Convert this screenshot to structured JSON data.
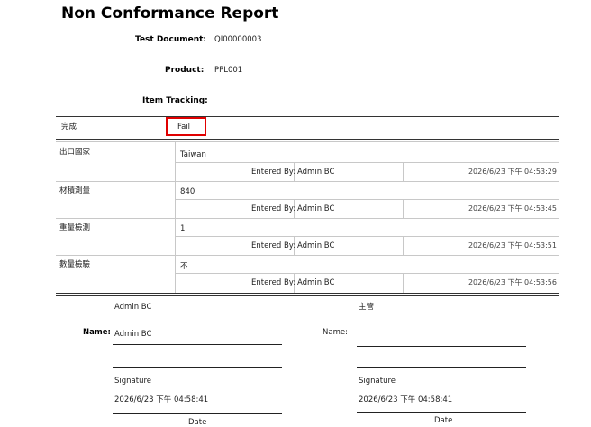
{
  "report": {
    "title": "Non Conformance Report",
    "test_document_label": "Test Document:",
    "test_document_value": "QI00000003",
    "product_label": "Product:",
    "product_value": "PPL001",
    "item_tracking_label": "Item Tracking:"
  },
  "status": {
    "label": "完成",
    "value": "Fail"
  },
  "entries": [
    {
      "name": "出口國家",
      "value": "Taiwan",
      "entered_by_label": "Entered By:",
      "entered_by": "Admin BC",
      "timestamp": "2026/6/23 下午 04:53:29"
    },
    {
      "name": "材積測量",
      "value": "840",
      "entered_by_label": "Entered By:",
      "entered_by": "Admin BC",
      "timestamp": "2026/6/23 下午 04:53:45"
    },
    {
      "name": "重量檢測",
      "value": "1",
      "entered_by_label": "Entered By:",
      "entered_by": "Admin BC",
      "timestamp": "2026/6/23 下午 04:53:51"
    },
    {
      "name": "數量檢驗",
      "value": "不",
      "entered_by_label": "Entered By:",
      "entered_by": "Admin BC",
      "timestamp": "2026/6/23 下午 04:53:56"
    }
  ],
  "signatures": {
    "left": {
      "header": "Admin BC",
      "name_label": "Name:",
      "name_value": "Admin BC",
      "signature_label": "Signature",
      "date_value": "2026/6/23 下午 04:58:41",
      "date_label": "Date"
    },
    "right": {
      "header": "主管",
      "name_label": "Name:",
      "signature_label": "Signature",
      "date_value": "2026/6/23 下午 04:58:41",
      "date_label": "Date"
    }
  }
}
